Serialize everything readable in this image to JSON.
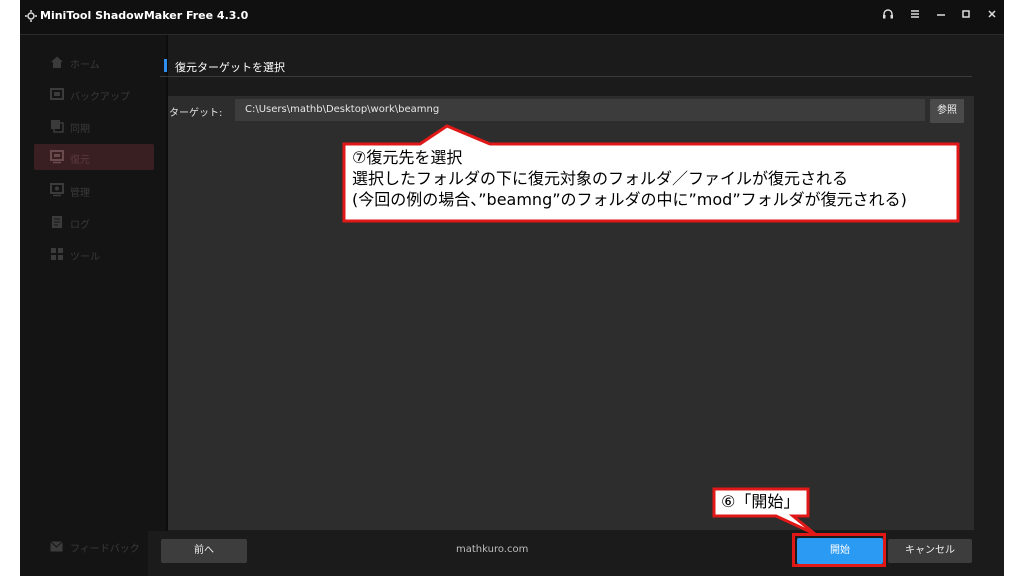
{
  "window": {
    "title": "MiniTool ShadowMaker Free 4.3.0",
    "controls": [
      "headset-icon",
      "menu-icon",
      "minimize-icon",
      "maximize-icon",
      "close-icon"
    ]
  },
  "sidebar": {
    "items": [
      {
        "label": "ホーム",
        "icon": "home-icon"
      },
      {
        "label": "バックアップ",
        "icon": "backup-icon"
      },
      {
        "label": "同期",
        "icon": "sync-icon"
      },
      {
        "label": "復元",
        "icon": "restore-icon",
        "active": true
      },
      {
        "label": "管理",
        "icon": "manage-icon"
      },
      {
        "label": "ログ",
        "icon": "log-icon"
      },
      {
        "label": "ツール",
        "icon": "tools-icon"
      }
    ],
    "feedback_label": "フィードバック"
  },
  "main": {
    "section_title": "復元ターゲットを選択",
    "target_label": "ターゲット:",
    "target_path": "C:\\Users\\mathb\\Desktop\\work\\beamng",
    "browse_label": "参照"
  },
  "footer": {
    "prev_label": "前へ",
    "site": "mathkuro.com",
    "start_label": "開始",
    "cancel_label": "キャンセル"
  },
  "annotations": {
    "callout_target": {
      "line1": "⑦復元先を選択",
      "line2": "選択したフォルダの下に復元対象のフォルダ／ファイルが復元される",
      "line3": "(今回の例の場合、”beamng”のフォルダの中に”mod”フォルダが復元される)"
    },
    "callout_start": "⑥「開始」",
    "highlight_color": "#e01818"
  }
}
